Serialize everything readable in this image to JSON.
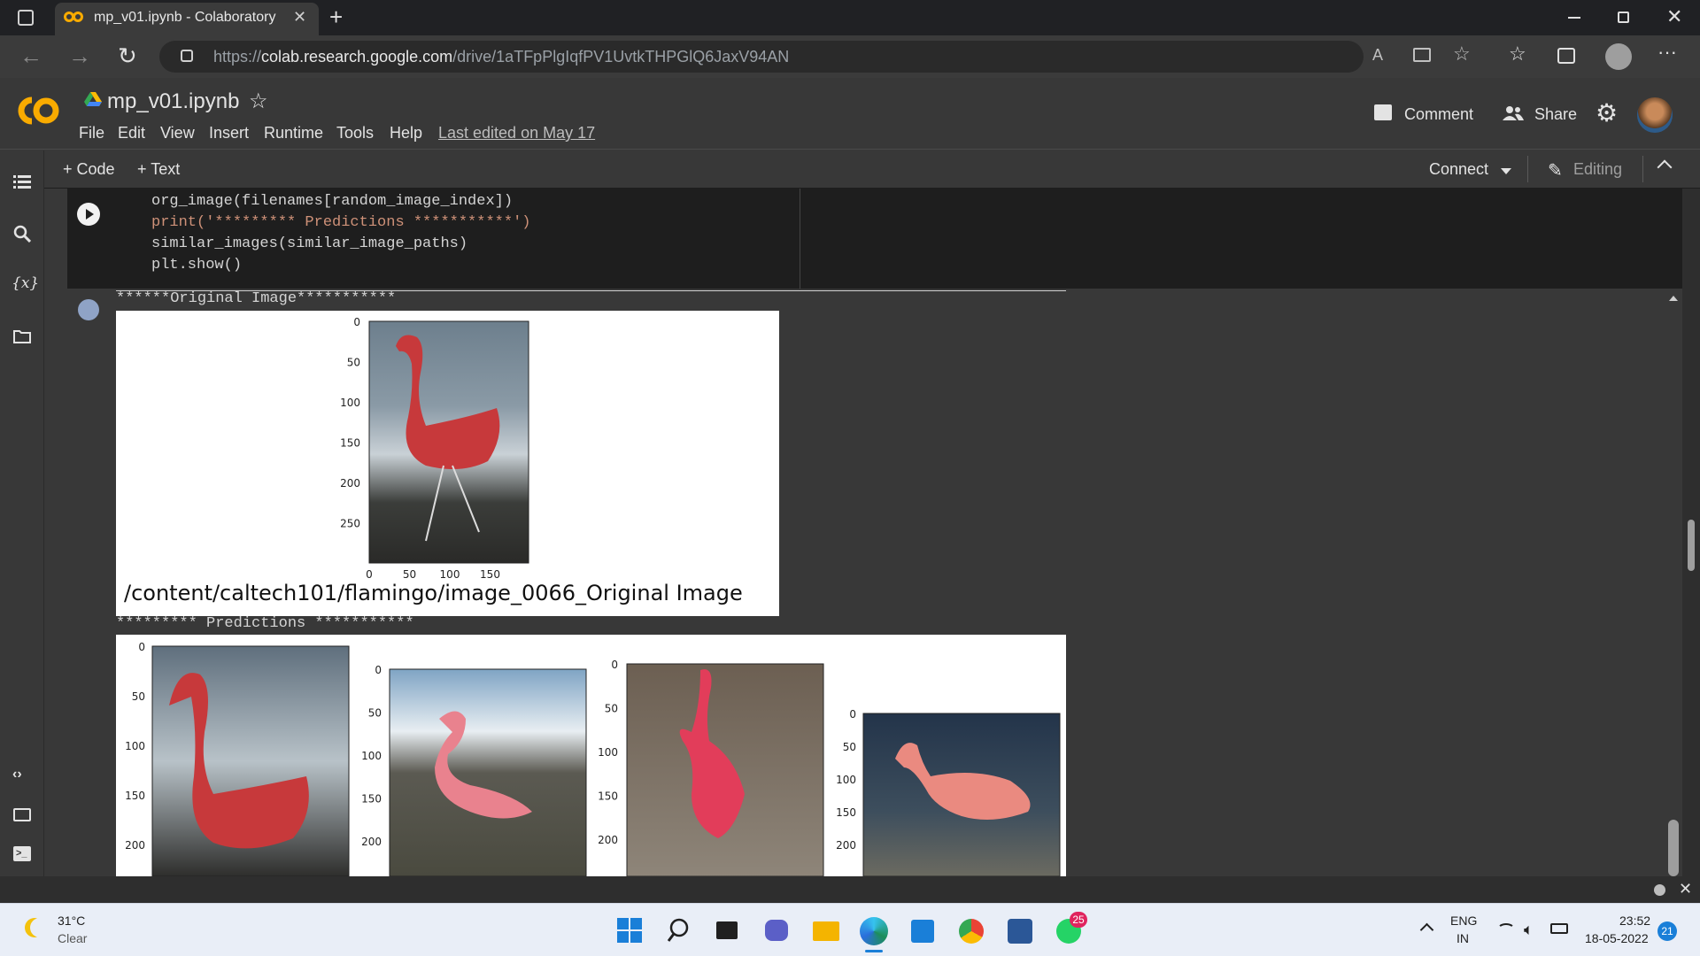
{
  "browser": {
    "tab_title": "mp_v01.ipynb - Colaboratory",
    "url_prefix": "https://",
    "url_host": "colab.research.google.com",
    "url_path": "/drive/1aTFpPlgIqfPV1UvtkTHPGlQ6JaxV94AN"
  },
  "colab": {
    "notebook_title": "mp_v01.ipynb",
    "menu": [
      "File",
      "Edit",
      "View",
      "Insert",
      "Runtime",
      "Tools",
      "Help"
    ],
    "last_edited": "Last edited on May 17",
    "comment_label": "Comment",
    "share_label": "Share",
    "add_code_label": "+ Code",
    "add_text_label": "+ Text",
    "connect_label": "Connect",
    "editing_label": "Editing"
  },
  "cell": {
    "code_lines": [
      "org_image(filenames[random_image_index])",
      "print('********* Predictions ***********')",
      "similar_images(similar_image_paths)",
      "plt.show()"
    ]
  },
  "output": {
    "original_header": "******Original Image***********",
    "original_caption": "/content/caltech101/flamingo/image_0066_Original Image",
    "predictions_header": "********* Predictions ***********"
  },
  "chart_data": [
    {
      "type": "image",
      "yticks": [
        "0",
        "50",
        "100",
        "150",
        "200",
        "250"
      ],
      "xticks": [
        "0",
        "50",
        "100",
        "150"
      ]
    },
    {
      "type": "image",
      "yticks": [
        "0",
        "50",
        "100",
        "150",
        "200"
      ]
    },
    {
      "type": "image",
      "yticks": [
        "0",
        "50",
        "100",
        "150",
        "200"
      ]
    },
    {
      "type": "image",
      "yticks": [
        "0",
        "50",
        "100",
        "150",
        "200"
      ]
    },
    {
      "type": "image",
      "yticks": [
        "0",
        "50",
        "100",
        "150",
        "200"
      ]
    }
  ],
  "taskbar": {
    "temperature": "31°C",
    "weather": "Clear",
    "whatsapp_badge": "25",
    "lang_top": "ENG",
    "lang_bottom": "IN",
    "time": "23:52",
    "date": "18-05-2022",
    "notification_count": "21"
  },
  "colors": {
    "colab_orange": "#f9ab00",
    "flamingo_pink": "#e85a6e"
  }
}
